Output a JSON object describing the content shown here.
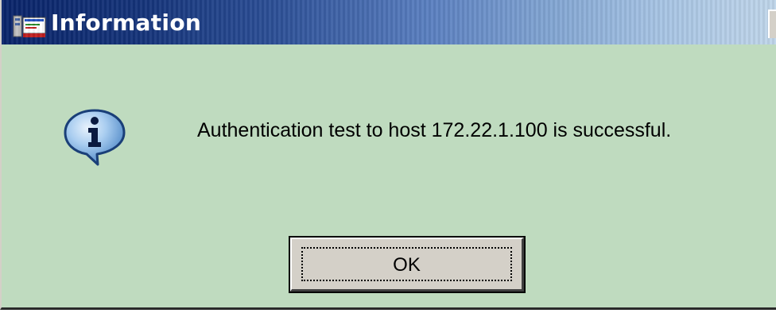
{
  "window": {
    "title": "Information",
    "title_icon": "app-icon"
  },
  "dialog": {
    "icon": "info-icon",
    "message": "Authentication test to host  172.22.1.100 is successful.",
    "ok_label": "OK"
  },
  "colors": {
    "title_gradient_start": "#0a246a",
    "title_gradient_end": "#c0d6ea",
    "dialog_background": "#bfdbbf",
    "button_face": "#d4d0c8",
    "info_icon_fill": "#6fa8dc"
  }
}
